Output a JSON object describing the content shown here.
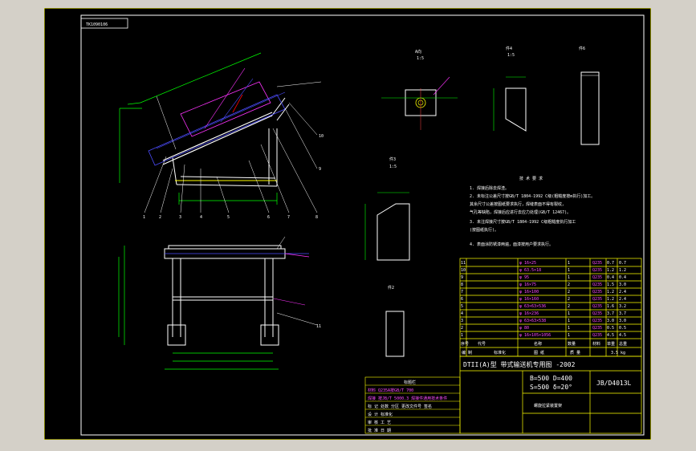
{
  "drawing": {
    "code_box": "TK1090106",
    "views": {
      "view_a": {
        "label": "A向",
        "scale": "1:5"
      },
      "view_4": {
        "label": "件4",
        "scale": "1:5"
      },
      "view_6": {
        "label": "件6"
      },
      "view_3": {
        "label": "件3",
        "scale": "1:5"
      },
      "view_2": {
        "label": "件2"
      }
    },
    "notes_title": "技 术 要 求",
    "notes": [
      "1. 焊接后除去焊渣。",
      "2. 未标注公差尺寸按GB/T 1804-1992 C级(粗糙度按m执行)加工。",
      "   其余尺寸公差按图纸要求执行，焊缝表面不得有裂纹，",
      "   气孔等缺陷，焊接后应进行去应力处理(GB/T 12467)。",
      "3. 未注焊接尺寸按GB/T 1804-1992 C级粗糙度执行加工",
      "   (按图纸执行)。",
      "4. 表面涂防锈漆两遍，面漆按用户要求执行。"
    ],
    "bom_rows": [
      [
        "11",
        "",
        "φ 16×25",
        "1",
        "Q235",
        "0.7",
        "0.7"
      ],
      [
        "10",
        "",
        "φ 63.5×18",
        "1",
        "Q235",
        "1.2",
        "1.2"
      ],
      [
        "9",
        "",
        "φ 95",
        "1",
        "Q235",
        "0.4",
        "0.4"
      ],
      [
        "8",
        "",
        "φ 16×75",
        "2",
        "Q235",
        "1.5",
        "3.0"
      ],
      [
        "7",
        "",
        "φ 16×100",
        "2",
        "Q235",
        "1.2",
        "2.4"
      ],
      [
        "6",
        "",
        "φ 16×160",
        "2",
        "Q235",
        "1.2",
        "2.4"
      ],
      [
        "5",
        "",
        "φ 63×63×536",
        "2",
        "Q235",
        "1.6",
        "3.2"
      ],
      [
        "4",
        "",
        "φ 16×236",
        "1",
        "Q235",
        "3.7",
        "3.7"
      ],
      [
        "3",
        "",
        "φ 63×63×538",
        "1",
        "Q235",
        "3.0",
        "3.0"
      ],
      [
        "2",
        "",
        "φ 80",
        "1",
        "Q235",
        "0.5",
        "0.5"
      ],
      [
        "1",
        "",
        "φ 16×105×1056",
        "1",
        "Q235",
        "4.5",
        "4.5"
      ]
    ],
    "bom_header": [
      "序号",
      "代号",
      "名称",
      "数量",
      "材料",
      "单重",
      "总重"
    ],
    "bom_footer": [
      "编 制",
      "标准化",
      "图 纸",
      "质 量",
      "3.5 kg"
    ],
    "project_title": "DTII(A)型 带式输送机专用图 -2002",
    "spec_line1": "B=500 D=400",
    "spec_line2": "S=500 δ=20°",
    "drawing_number": "JB/D4013L",
    "drawing_name": "螺旋拉紧装置架",
    "left_table_title": "标题栏",
    "left_table_rows": [
      "材料 Q235A按GB/T 700",
      "焊接 按JB/T 5000.3 焊接件通用技术条件",
      "标 记  处数  分区  更改文件号  签名",
      "设 计          标准化",
      "审 核          工 艺",
      "批 准          日 期"
    ],
    "balloons": [
      "1",
      "2",
      "3",
      "4",
      "5",
      "6",
      "7",
      "8",
      "9",
      "10",
      "11"
    ]
  }
}
